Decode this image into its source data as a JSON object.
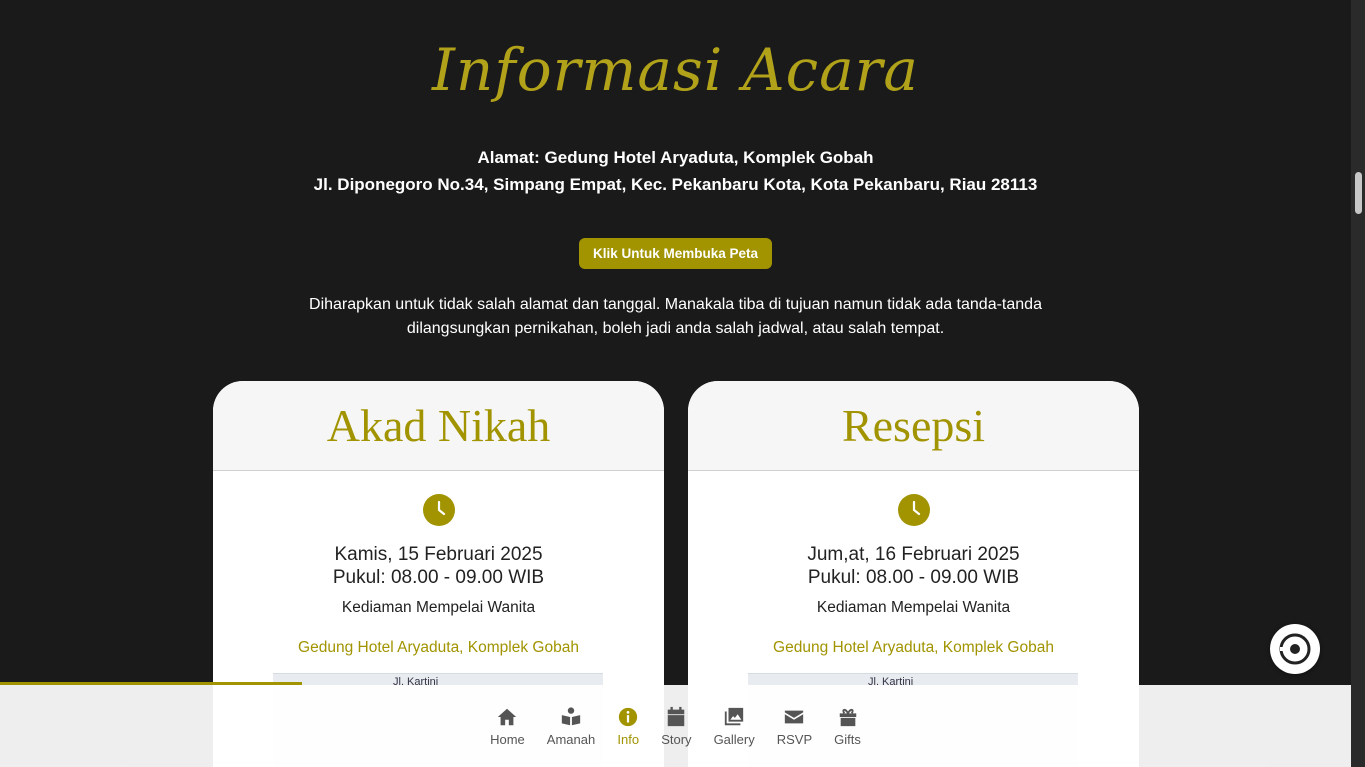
{
  "section": {
    "title": "Informasi Acara",
    "address_line1": "Alamat: Gedung Hotel Aryaduta, Komplek Gobah",
    "address_line2": "Jl. Diponegoro No.34, Simpang Empat, Kec. Pekanbaru Kota, Kota Pekanbaru, Riau 28113",
    "map_button": "Klik Untuk Membuka Peta",
    "notice": "Diharapkan untuk tidak salah alamat dan tanggal. Manakala tiba di tujuan namun tidak ada tanda-tanda dilangsungkan pernikahan, boleh jadi anda salah jadwal, atau salah tempat."
  },
  "events": [
    {
      "title": "Akad Nikah",
      "date": "Kamis, 15 Februari 2025",
      "time": "Pukul: 08.00 - 09.00 WIB",
      "place": "Kediaman Mempelai Wanita",
      "venue": "Gedung Hotel Aryaduta, Komplek Gobah",
      "map_label": "Jl. Kartini"
    },
    {
      "title": "Resepsi",
      "date": "Jum,at, 16 Februari 2025",
      "time": "Pukul: 08.00 - 09.00 WIB",
      "place": "Kediaman Mempelai Wanita",
      "venue": "Gedung Hotel Aryaduta, Komplek Gobah",
      "map_label": "Jl. Kartini"
    }
  ],
  "nav": [
    {
      "label": "Home",
      "icon": "home-icon"
    },
    {
      "label": "Amanah",
      "icon": "book-reader-icon"
    },
    {
      "label": "Info",
      "icon": "info-icon",
      "active": true
    },
    {
      "label": "Story",
      "icon": "calendar-icon"
    },
    {
      "label": "Gallery",
      "icon": "images-icon"
    },
    {
      "label": "RSVP",
      "icon": "envelope-icon"
    },
    {
      "label": "Gifts",
      "icon": "gift-icon"
    }
  ],
  "colors": {
    "accent": "#a19400",
    "background": "#1a1a1a"
  },
  "scroll_progress_fraction": 0.22
}
